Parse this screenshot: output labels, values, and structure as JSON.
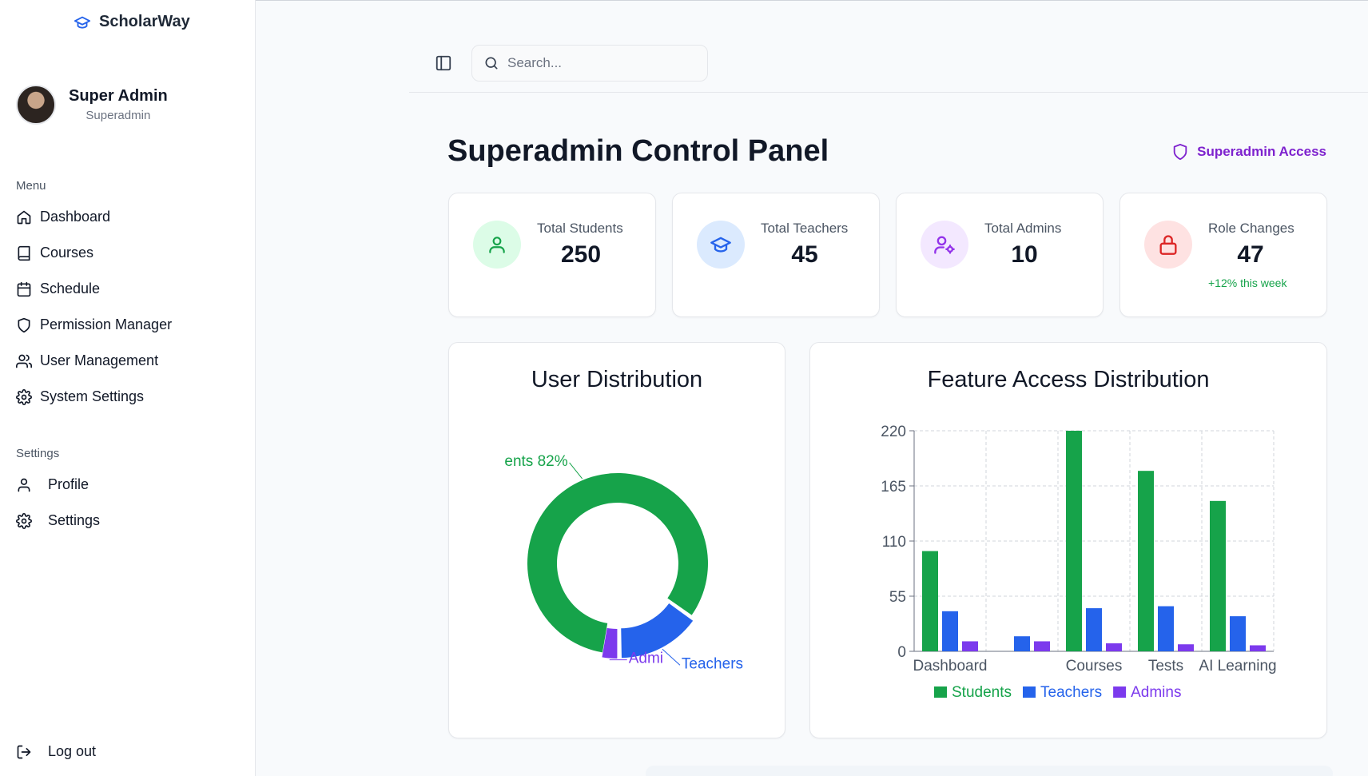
{
  "app": {
    "name": "ScholarWay"
  },
  "user": {
    "name": "Super Admin",
    "role": "Superadmin"
  },
  "menu": {
    "label": "Menu",
    "items": [
      {
        "label": "Dashboard",
        "icon": "home-icon"
      },
      {
        "label": "Courses",
        "icon": "book-icon"
      },
      {
        "label": "Schedule",
        "icon": "calendar-icon"
      },
      {
        "label": "Permission Manager",
        "icon": "shield-icon"
      },
      {
        "label": "User Management",
        "icon": "users-icon"
      },
      {
        "label": "System Settings",
        "icon": "gear-icon"
      }
    ]
  },
  "settings": {
    "label": "Settings",
    "items": [
      {
        "label": "Profile",
        "icon": "user-icon"
      },
      {
        "label": "Settings",
        "icon": "gear-icon"
      }
    ]
  },
  "logout": {
    "label": "Log out"
  },
  "search": {
    "placeholder": "Search..."
  },
  "page": {
    "title": "Superadmin Control Panel",
    "access_label": "Superadmin Access"
  },
  "stats": [
    {
      "label": "Total Students",
      "value": "250",
      "icon": "user-icon",
      "color": "#16a34a",
      "bg": "#dcfce7"
    },
    {
      "label": "Total Teachers",
      "value": "45",
      "icon": "graduation-cap-icon",
      "color": "#2563eb",
      "bg": "#dbeafe"
    },
    {
      "label": "Total Admins",
      "value": "10",
      "icon": "user-cog-icon",
      "color": "#9333ea",
      "bg": "#f3e8ff"
    },
    {
      "label": "Role Changes",
      "value": "47",
      "delta": "+12% this week",
      "icon": "lock-icon",
      "color": "#dc2626",
      "bg": "#fee2e2"
    }
  ],
  "colors": {
    "students": "#16a34a",
    "teachers": "#2563eb",
    "admins": "#7c3aed"
  },
  "chart_data": [
    {
      "type": "pie",
      "title": "User Distribution",
      "donut": true,
      "slices": [
        {
          "label": "Students",
          "value": 82,
          "visible_label": "ents 82%",
          "color": "#16a34a"
        },
        {
          "label": "Teachers",
          "value": 15,
          "visible_label": "Teachers ",
          "color": "#2563eb"
        },
        {
          "label": "Admins",
          "value": 3,
          "visible_label": "Admi",
          "color": "#7c3aed"
        }
      ]
    },
    {
      "type": "bar",
      "title": "Feature Access Distribution",
      "categories": [
        "Dashboard",
        "",
        "Courses",
        "Tests",
        "AI Learning"
      ],
      "ylim": [
        0,
        220
      ],
      "yticks": [
        0,
        55,
        110,
        165,
        220
      ],
      "grid": true,
      "legend": "bottom",
      "series": [
        {
          "name": "Students",
          "color": "#16a34a",
          "values": [
            100,
            0,
            220,
            180,
            150
          ]
        },
        {
          "name": "Teachers",
          "color": "#2563eb",
          "values": [
            40,
            15,
            43,
            45,
            35
          ]
        },
        {
          "name": "Admins",
          "color": "#7c3aed",
          "values": [
            10,
            10,
            8,
            7,
            6
          ]
        }
      ]
    }
  ]
}
